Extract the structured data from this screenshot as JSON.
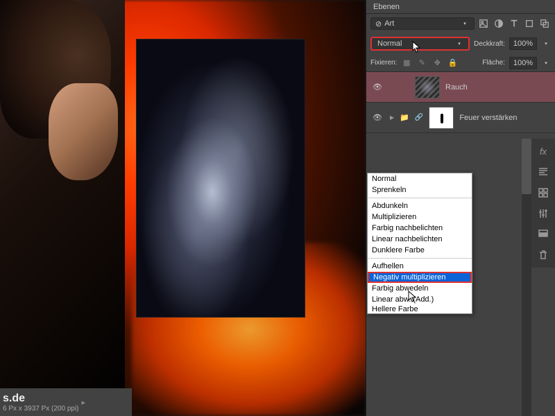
{
  "panel": {
    "title": "Ebenen",
    "search_label": "Art",
    "blend_mode": "Normal",
    "opacity_label": "Deckkraft:",
    "opacity_value": "100%",
    "fill_label": "Fläche:",
    "fill_value": "100%",
    "lock_label": "Fixieren:"
  },
  "layers": [
    {
      "name": "Rauch",
      "selected": true
    },
    {
      "name": "Feuer verstärken",
      "selected": false
    }
  ],
  "blend_modes": {
    "group1": [
      "Normal",
      "Sprenkeln"
    ],
    "group2": [
      "Abdunkeln",
      "Multiplizieren",
      "Farbig nachbelichten",
      "Linear nachbelichten",
      "Dunklere Farbe"
    ],
    "group3": [
      "Aufhellen",
      "Negativ multiplizieren",
      "Farbig abwedeln",
      "Linear abw. (Add.)",
      "Hellere Farbe"
    ],
    "selected": "Negativ multiplizieren"
  },
  "status": {
    "watermark": "s.de",
    "dims": "6 Px x 3937 Px (200 ppi)"
  }
}
